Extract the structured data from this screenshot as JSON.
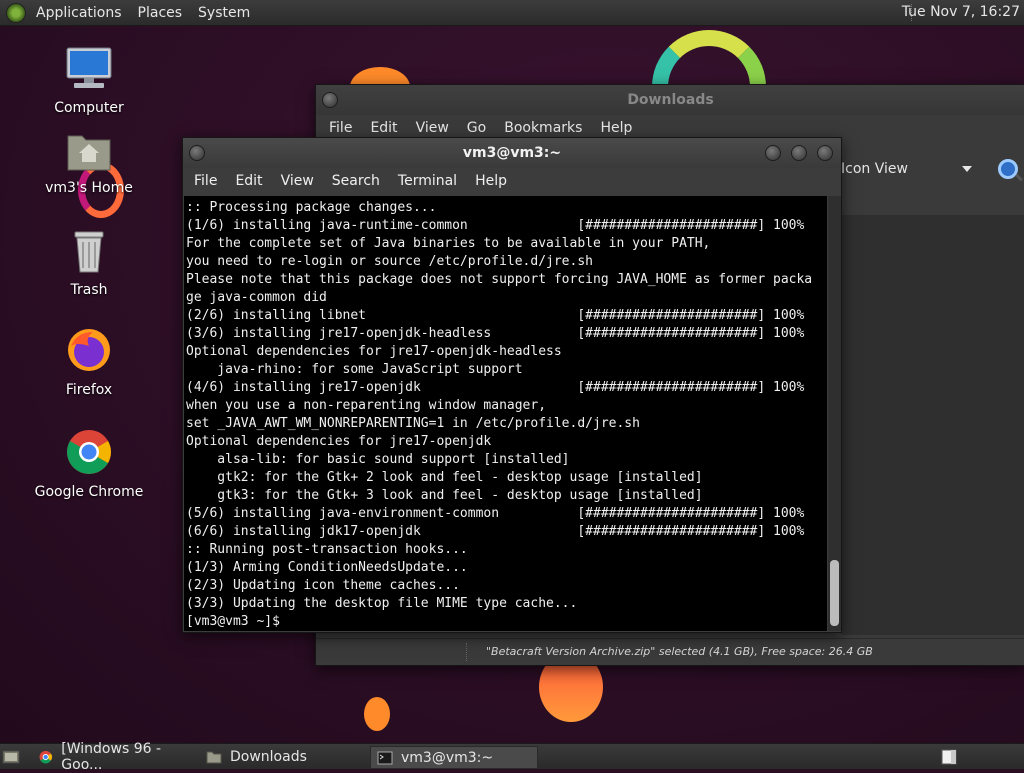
{
  "top_panel": {
    "menus": [
      "Applications",
      "Places",
      "System"
    ],
    "clock": "Tue Nov 7, 16:27"
  },
  "desktop": {
    "icons": [
      {
        "label": "Computer",
        "icon": "computer-icon"
      },
      {
        "label": "vm3's Home",
        "icon": "home-folder-icon"
      },
      {
        "label": "Trash",
        "icon": "trash-icon"
      },
      {
        "label": "Firefox",
        "icon": "firefox-icon"
      },
      {
        "label": "Google Chrome",
        "icon": "chrome-icon"
      }
    ]
  },
  "file_manager": {
    "title": "Downloads",
    "menu": [
      "File",
      "Edit",
      "View",
      "Go",
      "Bookmarks",
      "Help"
    ],
    "view_mode": "Icon View",
    "status": "\"Betacraft Version Archive.zip\" selected (4.1 GB), Free space: 26.4 GB"
  },
  "terminal": {
    "title": "vm3@vm3:~",
    "menu": [
      "File",
      "Edit",
      "View",
      "Search",
      "Terminal",
      "Help"
    ],
    "lines": [
      ":: Processing package changes...",
      "(1/6) installing java-runtime-common              [######################] 100%",
      "For the complete set of Java binaries to be available in your PATH,",
      "you need to re-login or source /etc/profile.d/jre.sh",
      "Please note that this package does not support forcing JAVA_HOME as former packa",
      "ge java-common did",
      "(2/6) installing libnet                           [######################] 100%",
      "(3/6) installing jre17-openjdk-headless           [######################] 100%",
      "Optional dependencies for jre17-openjdk-headless",
      "    java-rhino: for some JavaScript support",
      "(4/6) installing jre17-openjdk                    [######################] 100%",
      "when you use a non-reparenting window manager,",
      "set _JAVA_AWT_WM_NONREPARENTING=1 in /etc/profile.d/jre.sh",
      "Optional dependencies for jre17-openjdk",
      "    alsa-lib: for basic sound support [installed]",
      "    gtk2: for the Gtk+ 2 look and feel - desktop usage [installed]",
      "    gtk3: for the Gtk+ 3 look and feel - desktop usage [installed]",
      "(5/6) installing java-environment-common          [######################] 100%",
      "(6/6) installing jdk17-openjdk                    [######################] 100%",
      ":: Running post-transaction hooks...",
      "(1/3) Arming ConditionNeedsUpdate...",
      "(2/3) Updating icon theme caches...",
      "(3/3) Updating the desktop file MIME type cache...",
      "[vm3@vm3 ~]$ "
    ]
  },
  "taskbar": {
    "tasks": [
      {
        "label": "[Windows 96 - Goo...",
        "icon": "chrome-icon"
      },
      {
        "label": "Downloads",
        "icon": "folder-icon"
      },
      {
        "label": "vm3@vm3:~",
        "icon": "terminal-icon",
        "active": true
      }
    ]
  }
}
